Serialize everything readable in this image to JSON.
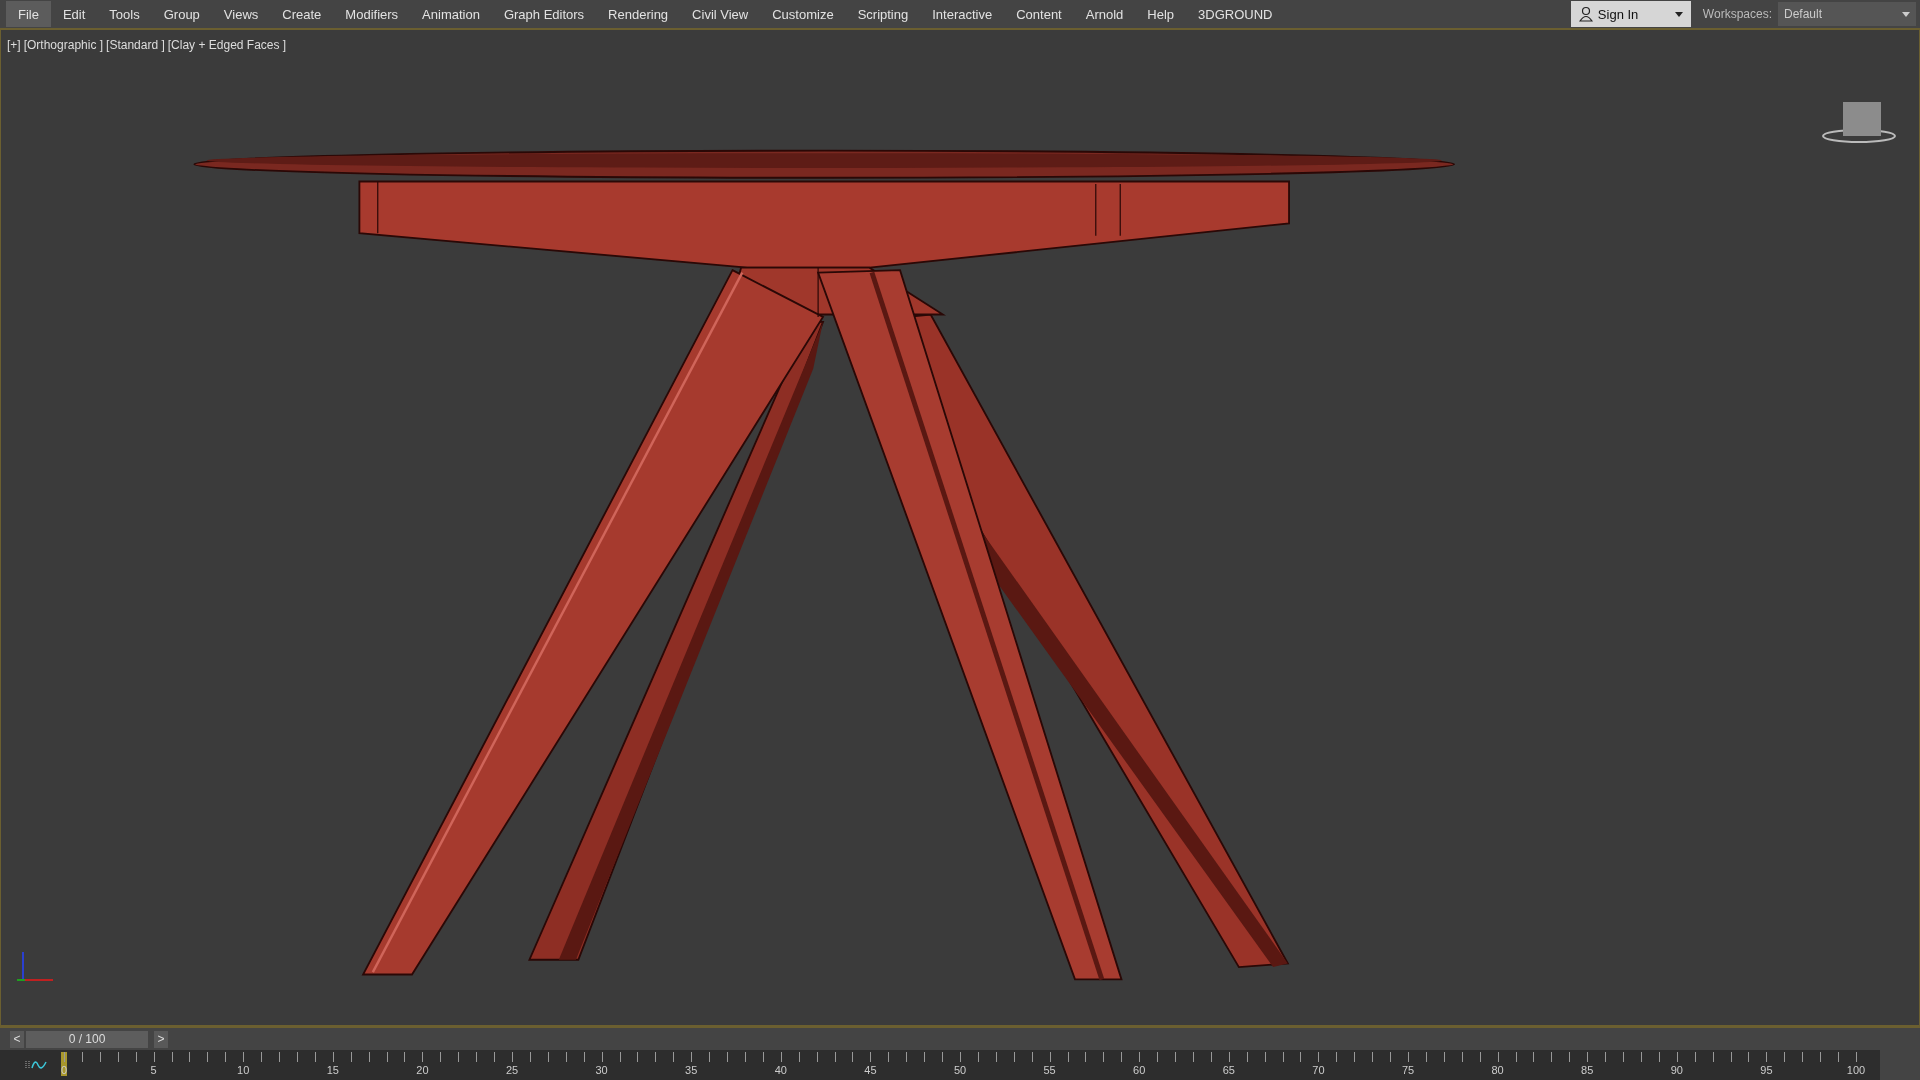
{
  "menu": [
    {
      "label": "File",
      "selected": true
    },
    {
      "label": "Edit",
      "selected": false
    },
    {
      "label": "Tools",
      "selected": false
    },
    {
      "label": "Group",
      "selected": false
    },
    {
      "label": "Views",
      "selected": false
    },
    {
      "label": "Create",
      "selected": false
    },
    {
      "label": "Modifiers",
      "selected": false
    },
    {
      "label": "Animation",
      "selected": false
    },
    {
      "label": "Graph Editors",
      "selected": false
    },
    {
      "label": "Rendering",
      "selected": false
    },
    {
      "label": "Civil View",
      "selected": false
    },
    {
      "label": "Customize",
      "selected": false
    },
    {
      "label": "Scripting",
      "selected": false
    },
    {
      "label": "Interactive",
      "selected": false
    },
    {
      "label": "Content",
      "selected": false
    },
    {
      "label": "Arnold",
      "selected": false
    },
    {
      "label": "Help",
      "selected": false
    },
    {
      "label": "3DGROUND",
      "selected": false
    }
  ],
  "sign_in": {
    "label": "Sign In"
  },
  "workspaces": {
    "label": "Workspaces:",
    "value": "Default"
  },
  "viewport": {
    "labels": [
      "[+]",
      "[Orthographic ]",
      "[Standard ]",
      "[Clay + Edged Faces ]"
    ]
  },
  "time_slider": {
    "prev": "<",
    "value": "0 / 100",
    "next": ">"
  },
  "timeline": {
    "ticks": [
      "0",
      "5",
      "10",
      "15",
      "20",
      "25",
      "30",
      "35",
      "40",
      "45",
      "50",
      "55",
      "60",
      "65",
      "70",
      "75",
      "80",
      "85",
      "90",
      "95",
      "100"
    ]
  }
}
